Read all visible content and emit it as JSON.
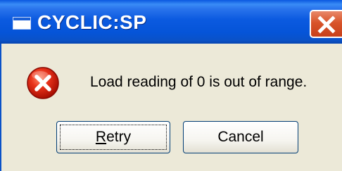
{
  "window": {
    "title": "CYCLIC:SP",
    "close_glyph": "✕"
  },
  "dialog": {
    "icon": "error-icon",
    "message": "Load reading of 0 is out of range.",
    "buttons": {
      "retry": {
        "mnemonic": "R",
        "rest": "etry"
      },
      "cancel": {
        "label": "Cancel"
      }
    }
  },
  "colors": {
    "titlebar": "#0554d8",
    "close_button": "#d8542a",
    "dialog_background": "#ece9d8",
    "error_red": "#d81e06"
  }
}
